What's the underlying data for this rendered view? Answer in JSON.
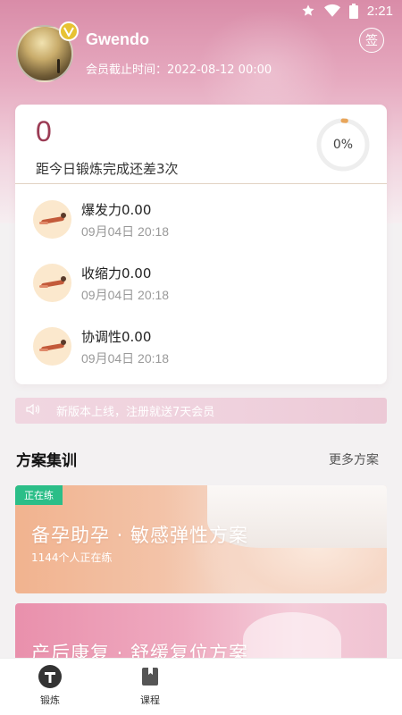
{
  "status_bar": {
    "time": "2:21",
    "icons": [
      "star-icon",
      "wifi-icon",
      "battery-icon"
    ]
  },
  "profile": {
    "username": "Gwendo",
    "vip_badge": "V",
    "member_expiry": "会员截止时间：2022-08-12 00:00",
    "sign_button": "签"
  },
  "today": {
    "count": "0",
    "remaining_text": "距今日锻炼完成还差3次",
    "progress_percent_label": "0%",
    "progress_fraction": 0.02
  },
  "metrics": [
    {
      "name": "爆发力0.00",
      "time": "09月04日 20:18"
    },
    {
      "name": "收缩力0.00",
      "time": "09月04日 20:18"
    },
    {
      "name": "协调性0.00",
      "time": "09月04日 20:18"
    }
  ],
  "announcement": {
    "icon": "speaker-icon",
    "text": "新版本上线，注册就送7天会员"
  },
  "plans_section": {
    "title": "方案集训",
    "more_label": "更多方案"
  },
  "plans": [
    {
      "tag": "正在练",
      "title": "备孕助孕 · 敏感弹性方案",
      "participants": "1144个人正在练"
    },
    {
      "title": "产后康复 · 舒缓复位方案"
    }
  ],
  "bottom_nav": [
    {
      "label": "锻炼",
      "icon": "dumbbell-t-icon",
      "active": true
    },
    {
      "label": "课程",
      "icon": "book-icon",
      "active": false
    }
  ],
  "colors": {
    "accent": "#9b3b54",
    "progress_ring": "#e8a55a",
    "tag_green": "#2bbe88",
    "header_pink": "#d98ca8"
  }
}
